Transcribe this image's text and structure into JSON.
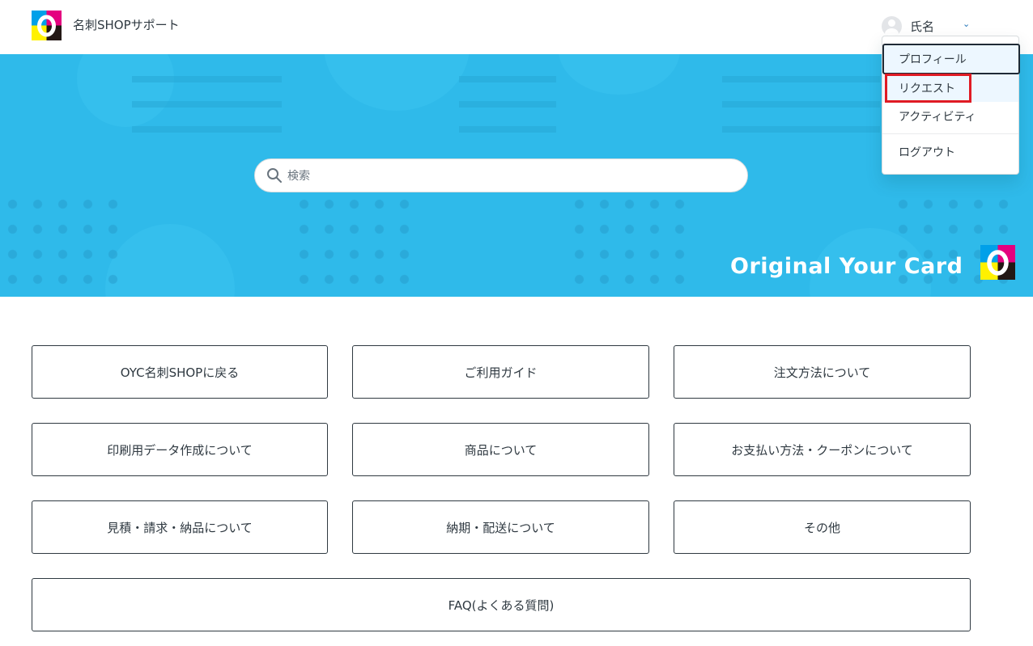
{
  "header": {
    "site_title": "名刺SHOPサポート",
    "user_name": "氏名",
    "chevron": "⌄"
  },
  "hero": {
    "search_placeholder": "検索",
    "brand_text": "Original Your Card"
  },
  "user_dropdown": {
    "items": [
      {
        "label": "プロフィール",
        "state": "focused"
      },
      {
        "label": "リクエスト",
        "state": "highlighted"
      },
      {
        "label": "アクティビティ"
      },
      {
        "label": "ログアウト"
      }
    ]
  },
  "categories": [
    {
      "label": "OYC名刺SHOPに戻る"
    },
    {
      "label": "ご利用ガイド"
    },
    {
      "label": "注文方法について"
    },
    {
      "label": "印刷用データ作成について"
    },
    {
      "label": "商品について"
    },
    {
      "label": "お支払い方法・クーポンについて"
    },
    {
      "label": "見積・請求・納品について"
    },
    {
      "label": "納期・配送について"
    },
    {
      "label": "その他"
    },
    {
      "label": "FAQ(よくある質問)"
    }
  ],
  "colors": {
    "hero_blue": "#2fbaea",
    "highlight_red": "#e01b24",
    "logo_cyan": "#00a0e9",
    "logo_magenta": "#e4007f",
    "logo_yellow": "#fff100",
    "logo_black": "#231815"
  },
  "icons": {
    "logo": "oyc-cmyk-logo-icon",
    "avatar": "user-avatar-icon",
    "search": "search-icon"
  }
}
